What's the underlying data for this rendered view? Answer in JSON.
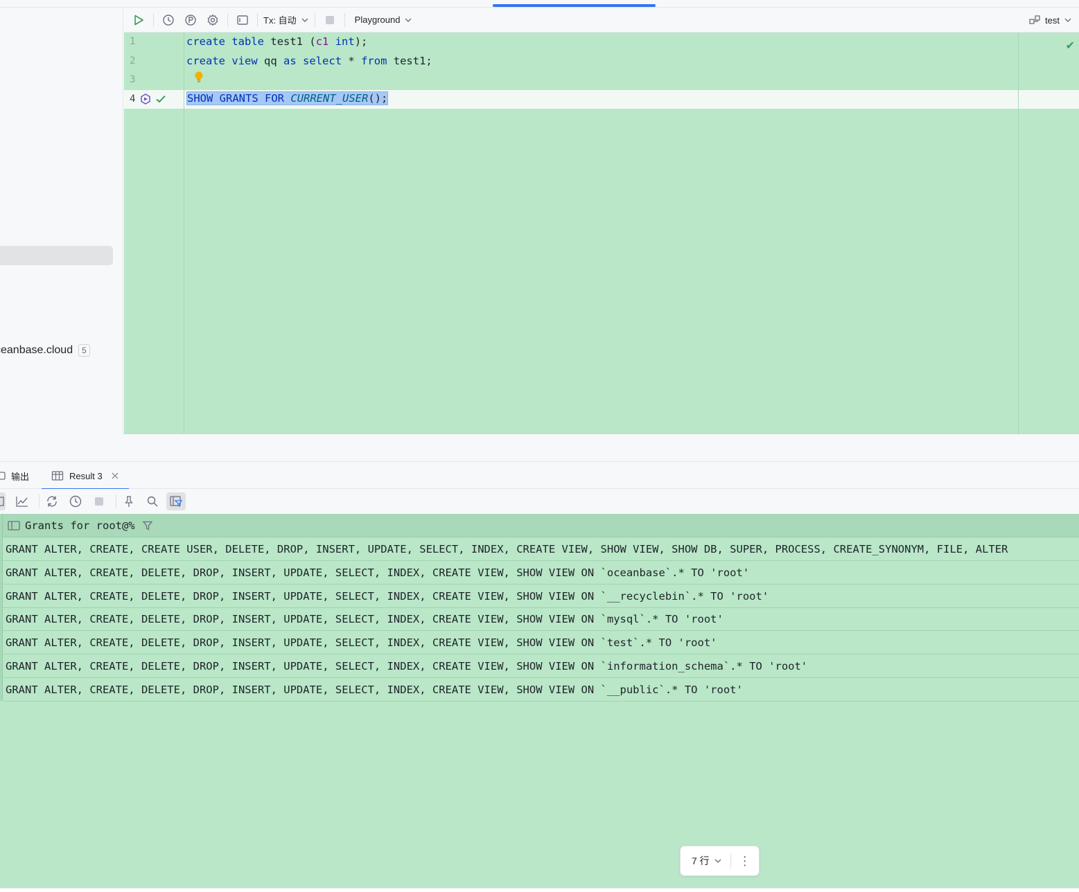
{
  "toolbar": {
    "tx_label": "Tx: 自动",
    "schema_label": "Playground",
    "datasource_label": "test"
  },
  "left_panel": {
    "connection_label": "ceanbase.cloud",
    "connection_count": "5"
  },
  "editor": {
    "line_numbers": [
      "1",
      "2",
      "3",
      "4"
    ],
    "lines": {
      "l1": {
        "t1": "create",
        "t2": "table",
        "t3": "test1 (",
        "t4": "c1",
        "t5": "int",
        "t6": ");"
      },
      "l2": {
        "t1": "create",
        "t2": "view",
        "t3": "qq",
        "t4": "as",
        "t5": "select",
        "t6": "*",
        "t7": "from",
        "t8": "test1;"
      },
      "l4": {
        "t1": "SHOW",
        "t2": "GRANTS",
        "t3": "FOR",
        "t4": "CURRENT_USER",
        "t5": "();"
      }
    }
  },
  "result_tabs": {
    "output_label": "输出",
    "result_label": "Result 3"
  },
  "grid": {
    "column_header": "Grants for root@%",
    "rows": [
      "GRANT ALTER, CREATE, CREATE USER, DELETE, DROP, INSERT, UPDATE, SELECT, INDEX, CREATE VIEW, SHOW VIEW, SHOW DB, SUPER, PROCESS, CREATE_SYNONYM, FILE, ALTER",
      "GRANT ALTER, CREATE, DELETE, DROP, INSERT, UPDATE, SELECT, INDEX, CREATE VIEW, SHOW VIEW ON `oceanbase`.* TO 'root'",
      "GRANT ALTER, CREATE, DELETE, DROP, INSERT, UPDATE, SELECT, INDEX, CREATE VIEW, SHOW VIEW ON `__recyclebin`.* TO 'root'",
      "GRANT ALTER, CREATE, DELETE, DROP, INSERT, UPDATE, SELECT, INDEX, CREATE VIEW, SHOW VIEW ON `mysql`.* TO 'root'",
      "GRANT ALTER, CREATE, DELETE, DROP, INSERT, UPDATE, SELECT, INDEX, CREATE VIEW, SHOW VIEW ON `test`.* TO 'root'",
      "GRANT ALTER, CREATE, DELETE, DROP, INSERT, UPDATE, SELECT, INDEX, CREATE VIEW, SHOW VIEW ON `information_schema`.* TO 'root'",
      "GRANT ALTER, CREATE, DELETE, DROP, INSERT, UPDATE, SELECT, INDEX, CREATE VIEW, SHOW VIEW ON `__public`.* TO 'root'"
    ]
  },
  "pager": {
    "row_count_label": "7 行"
  },
  "colors": {
    "accent": "#3574f0",
    "editor_bg": "#b9e7c8",
    "success": "#3c9a5f"
  }
}
